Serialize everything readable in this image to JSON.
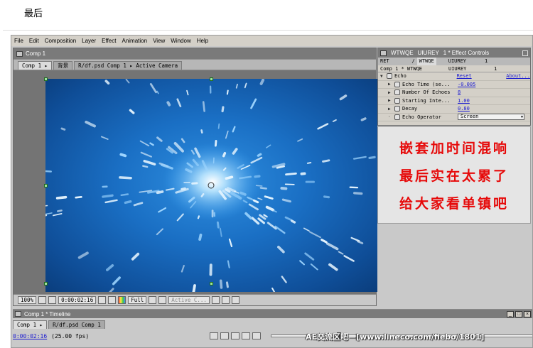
{
  "page": {
    "heading": "最后"
  },
  "menu": [
    "File",
    "Edit",
    "Composition",
    "Layer",
    "Effect",
    "Animation",
    "View",
    "Window",
    "Help"
  ],
  "comp_window": {
    "title": "Comp 1",
    "tabs": [
      "Comp 1 ▸",
      "背景",
      "R/df.psd Comp 1 ▸ Active Camera"
    ],
    "toolbar": {
      "zoom": "100%",
      "timecode": "0:00:02:16",
      "resolution": "Full",
      "view": "Active C..."
    }
  },
  "effect_controls": {
    "title_left": "WTWQE",
    "title_mid": "UIUREY",
    "title_right": "1 * Effect Controls",
    "tabs": [
      "RET",
      "/",
      "WTWQE",
      "UIUREY",
      "1"
    ],
    "subheader": [
      "Comp 1 * WTWQE",
      "UIUREY",
      "1"
    ],
    "effect_name": "Echo",
    "reset_label": "Reset",
    "about_label": "About...",
    "params": [
      {
        "name": "Echo Time (se...",
        "value": "-0.005"
      },
      {
        "name": "Number Of Echoes",
        "value": "8"
      },
      {
        "name": "Starting Inte...",
        "value": "1.00"
      },
      {
        "name": "Decay",
        "value": "0.80"
      }
    ],
    "operator_label": "Echo Operator",
    "operator_value": "Screen"
  },
  "caption": {
    "lines": [
      "嵌套加时间混响",
      "最后实在太累了",
      "给大家看单镇吧"
    ],
    "color": "#e60a0a"
  },
  "timeline": {
    "title": "Comp 1 * Timeline",
    "tabs": [
      "Comp 1 ▸",
      "R/df.psd Comp 1"
    ],
    "timecode": "0:00:02:16",
    "fps": "(25.00 fps)"
  },
  "watermark": "AE交流区吧—[www.lineco.com/fiebo/1801]"
}
